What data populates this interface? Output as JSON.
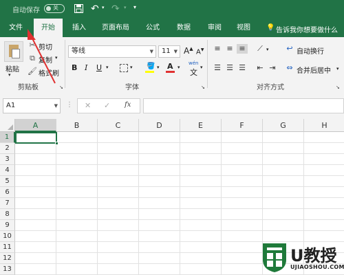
{
  "titlebar": {
    "autosave_label": "自动保存",
    "autosave_state": "关",
    "more_icon": "customize-arrow"
  },
  "tabs": [
    {
      "label": "文件"
    },
    {
      "label": "开始"
    },
    {
      "label": "插入"
    },
    {
      "label": "页面布局"
    },
    {
      "label": "公式"
    },
    {
      "label": "数据"
    },
    {
      "label": "审阅"
    },
    {
      "label": "视图"
    }
  ],
  "tell_me": "告诉我你想要做什么",
  "clipboard": {
    "paste": "粘贴",
    "cut": "剪切",
    "copy": "复制",
    "format_painter": "格式刷",
    "group": "剪贴板"
  },
  "font": {
    "name": "等线",
    "size": "11",
    "bold": "B",
    "italic": "I",
    "underline": "U",
    "grow": "A",
    "shrink": "A",
    "wen": "wén",
    "group": "字体"
  },
  "alignment": {
    "wrap": "自动换行",
    "merge": "合并后居中",
    "group": "对齐方式"
  },
  "formula": {
    "cell_ref": "A1",
    "fx": "fx",
    "cancel": "✕",
    "enter": "✓",
    "value": ""
  },
  "grid": {
    "columns": [
      "A",
      "B",
      "C",
      "D",
      "E",
      "F",
      "G",
      "H"
    ],
    "rows": [
      "1",
      "2",
      "3",
      "4",
      "5",
      "6",
      "7",
      "8",
      "9",
      "10",
      "11",
      "12",
      "13"
    ],
    "selected": "A1"
  },
  "watermark": {
    "brand": "U教授",
    "url": "UJIAOSHOU.COM"
  },
  "colors": {
    "accent": "#217346",
    "annotation": "#e03131"
  }
}
